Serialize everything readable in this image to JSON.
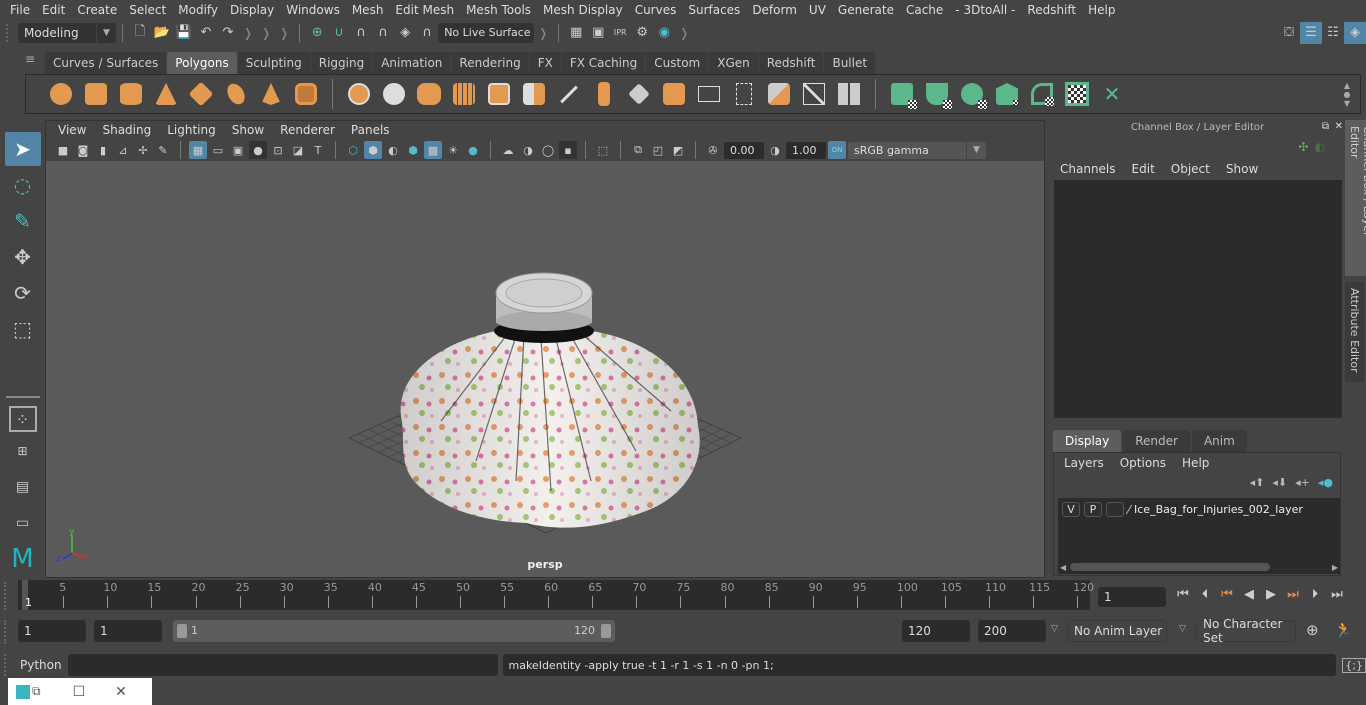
{
  "menubar": [
    "File",
    "Edit",
    "Create",
    "Select",
    "Modify",
    "Display",
    "Windows",
    "Mesh",
    "Edit Mesh",
    "Mesh Tools",
    "Mesh Display",
    "Curves",
    "Surfaces",
    "Deform",
    "UV",
    "Generate",
    "Cache",
    "- 3DtoAll -",
    "Redshift",
    "Help"
  ],
  "statusline": {
    "workspace": "Modeling",
    "live_surface": "No Live Surface"
  },
  "shelf": {
    "tabs": [
      "Curves / Surfaces",
      "Polygons",
      "Sculpting",
      "Rigging",
      "Animation",
      "Rendering",
      "FX",
      "FX Caching",
      "Custom",
      "XGen",
      "Redshift",
      "Bullet"
    ],
    "active_tab": "Polygons",
    "poly_icons": [
      "sphere-icon",
      "cube-icon",
      "cylinder-icon",
      "cone-icon",
      "diamond-icon",
      "torus-icon",
      "pyramid-icon",
      "pipe-icon"
    ],
    "edit_icons": [
      "combine-icon",
      "separate-icon",
      "mirror-icon",
      "smooth-icon",
      "bevel-cube-icon",
      "subdivide-icon",
      "multi-cut-icon",
      "extrude-icon",
      "bridge-icon",
      "merge-icon",
      "insert-loop-icon",
      "append-icon",
      "fill-hole-icon",
      "bevel-icon",
      "quad-draw-icon"
    ],
    "uv_icons": [
      "uv-planar-icon",
      "uv-cylindrical-icon",
      "uv-spherical-icon",
      "uv-auto-icon",
      "uv-contour-icon",
      "uv-editor-icon",
      "uv-unfold-icon"
    ]
  },
  "viewport": {
    "menu": [
      "View",
      "Shading",
      "Lighting",
      "Show",
      "Renderer",
      "Panels"
    ],
    "exposure": "0.00",
    "gamma": "1.00",
    "color_space": "sRGB gamma",
    "color_mgmt": "ON",
    "camera": "persp",
    "axes": {
      "x": "x",
      "y": "y",
      "z": "z"
    }
  },
  "channel_box": {
    "title": "Channel Box / Layer Editor",
    "menu": [
      "Channels",
      "Edit",
      "Object",
      "Show"
    ]
  },
  "layer_editor": {
    "tabs": [
      "Display",
      "Render",
      "Anim"
    ],
    "active_tab": "Display",
    "menu": [
      "Layers",
      "Options",
      "Help"
    ],
    "layers": [
      {
        "v": "V",
        "p": "P",
        "name": "Ice_Bag_for_Injuries_002_layer"
      }
    ]
  },
  "side_tabs": [
    "Channel Box / Layer Editor",
    "Attribute Editor"
  ],
  "timeline": {
    "ticks": [
      5,
      10,
      15,
      20,
      25,
      30,
      35,
      40,
      45,
      50,
      55,
      60,
      65,
      70,
      75,
      80,
      85,
      90,
      95,
      100,
      105,
      110,
      115,
      120
    ],
    "current_frame_marker": "1",
    "current_frame": "1"
  },
  "range": {
    "start": "1",
    "playback_start": "1",
    "slider_start": "1",
    "slider_end": "120",
    "playback_end": "120",
    "end": "200",
    "anim_layer": "No Anim Layer",
    "character_set": "No Character Set"
  },
  "command": {
    "lang": "Python",
    "input": "",
    "result": "makeIdentity -apply true -t 1 -r 1 -s 1 -n 0 -pn 1;"
  }
}
